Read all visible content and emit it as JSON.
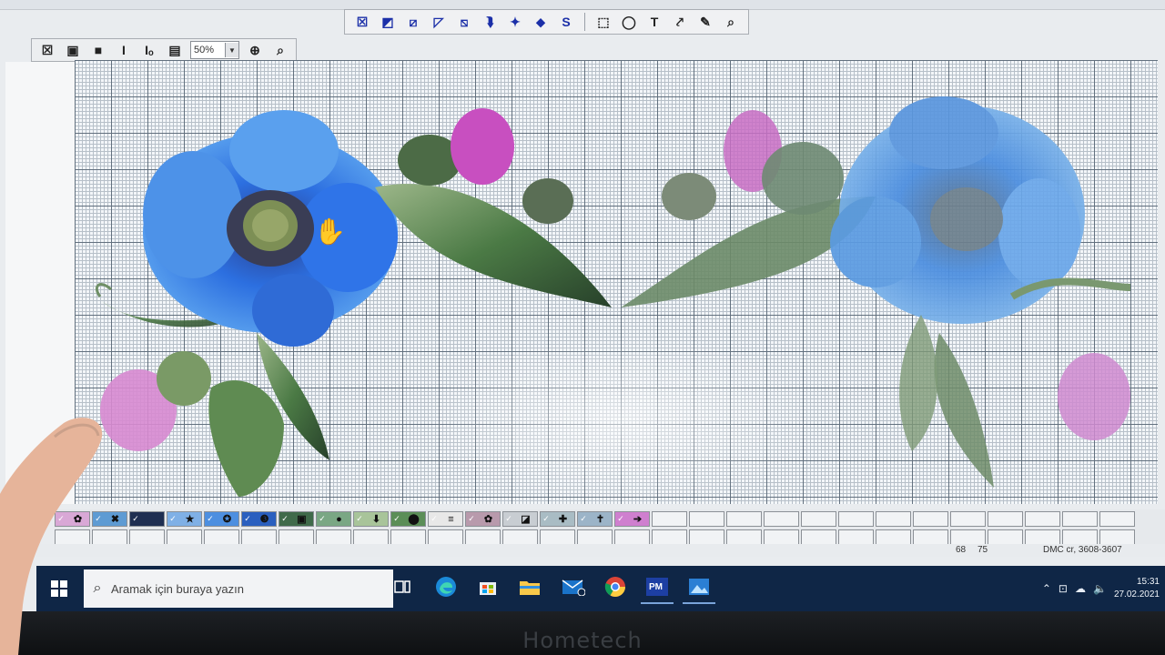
{
  "toolbar_main": {
    "tools": [
      {
        "icon": "cross-stitch-icon",
        "glyph": "☒"
      },
      {
        "icon": "half-stitch-tl-icon",
        "glyph": "◩"
      },
      {
        "icon": "half-stitch-diag-icon",
        "glyph": "⧄"
      },
      {
        "icon": "quarter-stitch-icon",
        "glyph": "◸"
      },
      {
        "icon": "three-quarter-stitch-icon",
        "glyph": "⧅"
      },
      {
        "icon": "backstitch-icon",
        "glyph": "⮯"
      },
      {
        "icon": "french-knot-icon",
        "glyph": "✦"
      },
      {
        "icon": "bead-icon",
        "glyph": "⬥"
      },
      {
        "icon": "special-stitch-icon",
        "glyph": "S"
      },
      {
        "icon": "select-rect-icon",
        "glyph": "⬚"
      },
      {
        "icon": "lasso-icon",
        "glyph": "◯"
      },
      {
        "icon": "text-icon",
        "glyph": "T"
      },
      {
        "icon": "fill-icon",
        "glyph": "⤤"
      },
      {
        "icon": "color-picker-icon",
        "glyph": "✎"
      },
      {
        "icon": "zoom-icon",
        "glyph": "⌕"
      }
    ]
  },
  "toolbar_view": {
    "tools": [
      {
        "icon": "view-stitches-icon",
        "glyph": "☒"
      },
      {
        "icon": "view-symbols-icon",
        "glyph": "▣"
      },
      {
        "icon": "view-blocks-icon",
        "glyph": "■"
      },
      {
        "icon": "italic-icon",
        "glyph": "I"
      },
      {
        "icon": "italic-indent-icon",
        "glyph": "Iₒ"
      },
      {
        "icon": "page-icon",
        "glyph": "▤"
      }
    ],
    "zoom_value": "50%",
    "fit_icon": "fit-to-window-icon",
    "zoom_tool_icon": "zoom-tool-icon"
  },
  "palette": {
    "swatches": [
      {
        "color": "#d9a8d6",
        "symbol": "✿"
      },
      {
        "color": "#5e9bd3",
        "symbol": "✖"
      },
      {
        "color": "#1f2f52",
        "symbol": ""
      },
      {
        "color": "#7fb0e6",
        "symbol": "★"
      },
      {
        "color": "#4d8fe0",
        "symbol": "✪"
      },
      {
        "color": "#2a5fbf",
        "symbol": "❸"
      },
      {
        "color": "#3f6a4a",
        "symbol": "▣"
      },
      {
        "color": "#7aa784",
        "symbol": "●"
      },
      {
        "color": "#a8c49a",
        "symbol": "⬇"
      },
      {
        "color": "#5b8e57",
        "symbol": "⬤"
      },
      {
        "color": "#e8e8e8",
        "symbol": "≡"
      },
      {
        "color": "#b89aac",
        "symbol": "✿"
      },
      {
        "color": "#c8cdd2",
        "symbol": "◪"
      },
      {
        "color": "#a9bcc4",
        "symbol": "✚"
      },
      {
        "color": "#9cb4c8",
        "symbol": "✝"
      },
      {
        "color": "#cf7fcf",
        "symbol": "➔"
      }
    ],
    "empty_count_row1": 13,
    "empty_count_row2": 29
  },
  "status": {
    "x": "68",
    "y": "75",
    "thread": "DMC  cr, 3608-3607"
  },
  "taskbar": {
    "search_placeholder": "Aramak için buraya yazın",
    "time": "15:31",
    "date": "27.02.2021"
  },
  "brand": "Hometech"
}
